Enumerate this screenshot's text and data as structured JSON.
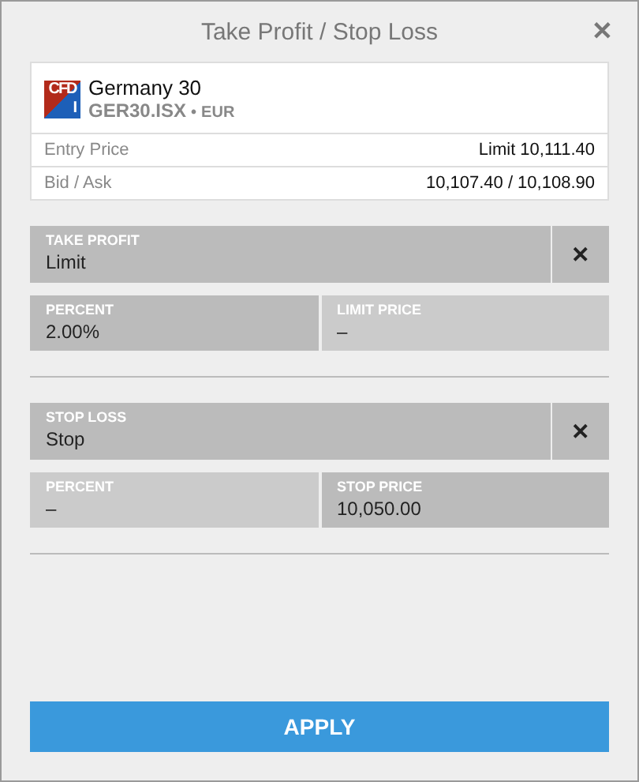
{
  "window": {
    "title": "Take Profit / Stop Loss",
    "close": "✕"
  },
  "instrument": {
    "logo_top": "CFD",
    "logo_bottom": "I",
    "name": "Germany 30",
    "symbol": "GER30.ISX",
    "separator": "•",
    "currency": "EUR"
  },
  "details": [
    {
      "label": "Entry Price",
      "value": "Limit 10,111.40"
    },
    {
      "label": "Bid / Ask",
      "value": "10,107.40 / 10,108.90"
    }
  ],
  "orders": [
    {
      "label": "TAKE PROFIT",
      "value": "Limit",
      "remove": "✕",
      "fields": [
        {
          "label": "PERCENT",
          "value": "2.00%",
          "active": true
        },
        {
          "label": "LIMIT PRICE",
          "placeholder": "–",
          "active": false
        }
      ]
    },
    {
      "label": "STOP LOSS",
      "value": "Stop",
      "remove": "✕",
      "fields": [
        {
          "label": "PERCENT",
          "placeholder": "–",
          "active": false
        },
        {
          "label": "STOP PRICE",
          "value": "10,050.00",
          "active": true
        }
      ]
    }
  ],
  "apply": "APPLY"
}
